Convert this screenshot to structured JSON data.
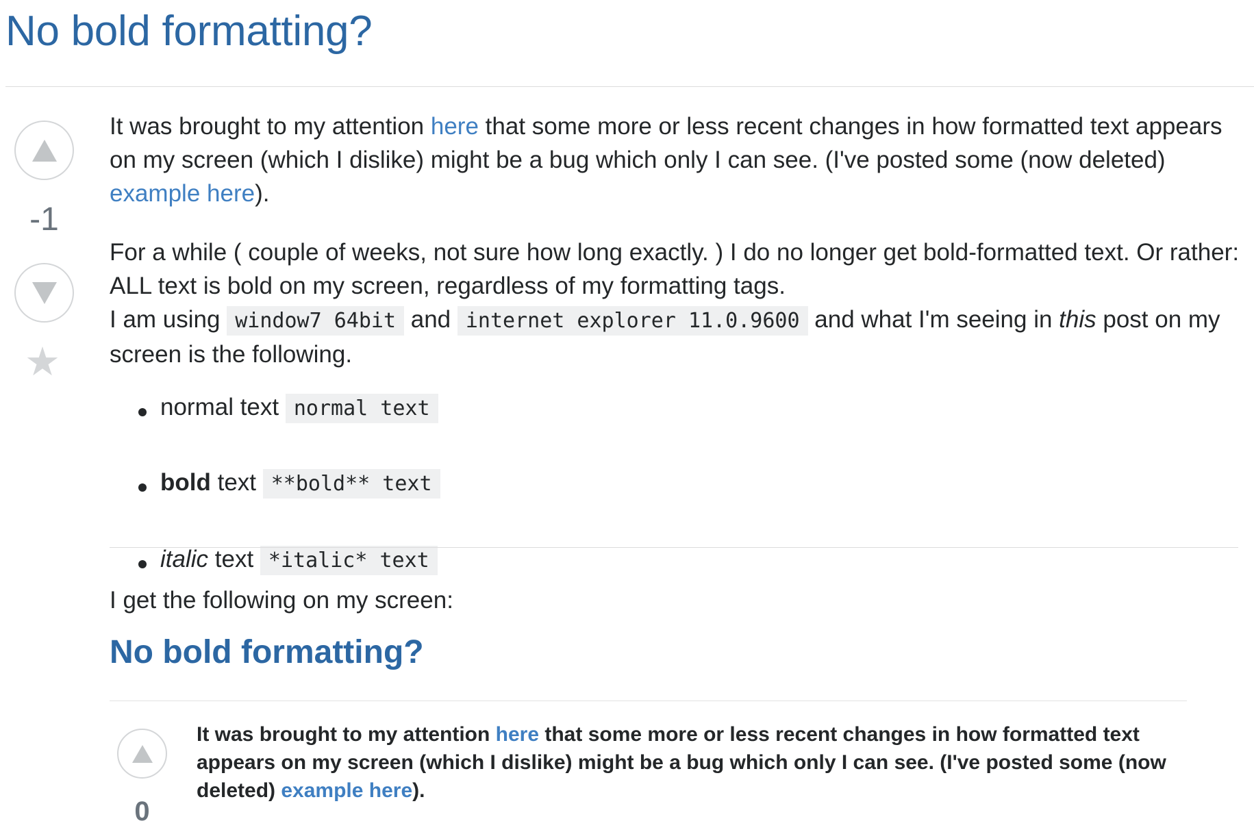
{
  "question": {
    "title": "No bold formatting?",
    "score": "-1"
  },
  "body": {
    "p1_a": "It was brought to my attention ",
    "p1_link1": "here",
    "p1_b": " that some more or less recent changes in how formatted text appears on my screen (which I dislike) might be a bug which only I can see. (I've posted some (now deleted) ",
    "p1_link2": "example here",
    "p1_c": ").",
    "p2_a": "For a while ( couple of weeks, not sure how long exactly. ) I do no longer get bold-formatted text. Or rather: ALL text is bold on my screen, regardless of my formatting tags.",
    "p2_b": "I am using ",
    "p2_code1": "window7 64bit",
    "p2_c": " and ",
    "p2_code2": "internet explorer 11.0.9600",
    "p2_d": " and what I'm seeing in ",
    "p2_em": "this",
    "p2_e": " post on my screen is the following.",
    "list": [
      {
        "lead": "normal",
        "rest": " text ",
        "code": "normal text"
      },
      {
        "lead": "bold",
        "rest": " text ",
        "code": "**bold** text"
      },
      {
        "lead": "italic",
        "rest": " text ",
        "code": "*italic* text"
      }
    ],
    "p3": "I get the following on my screen:"
  },
  "screenshot": {
    "title": "No bold formatting?",
    "score": "0",
    "text_a": "It was brought to my attention ",
    "link1": "here",
    "text_b": " that some more or less recent changes in how formatted text appears on my screen (which I dislike) might be a bug which only I can see. (I've posted some (now deleted) ",
    "link2": "example here",
    "text_c": ")."
  },
  "icons": {
    "upvote": "triangle-up-icon",
    "downvote": "triangle-down-icon",
    "favorite": "star-icon"
  },
  "colors": {
    "title": "#2c67a3",
    "link": "#3f7fc2",
    "vote_border": "#d4d6d8",
    "code_bg": "#eff0f1"
  }
}
